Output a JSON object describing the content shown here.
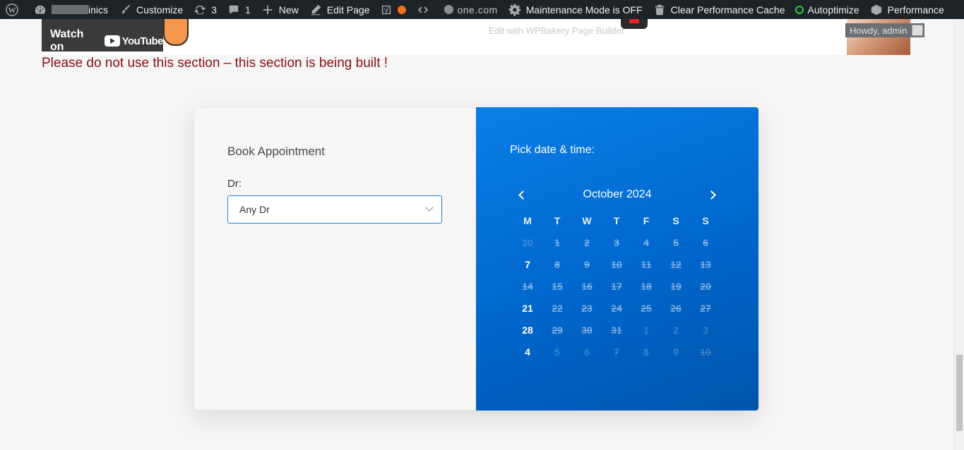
{
  "adminbar": {
    "site_suffix": "inics",
    "customize": "Customize",
    "updates_count": "3",
    "comments_count": "1",
    "new": "New",
    "edit_page": "Edit Page",
    "onecom": "one.com",
    "maintenance": "Maintenance Mode is OFF",
    "clear_cache": "Clear Performance Cache",
    "autoptimize": "Autoptimize",
    "performance": "Performance"
  },
  "video": {
    "watch_on": "Watch on",
    "youtube": "YouTube",
    "wpbakery": "Edit with WPBakery Page Builder",
    "howdy": "Howdy, admin"
  },
  "warning_text": "Please do not use this section – this section is being built !",
  "booking": {
    "title": "Book Appointment",
    "dr_label": "Dr:",
    "dr_value": "Any Dr",
    "pick_title": "Pick date & time:",
    "month": "October 2024",
    "weekdays": [
      "M",
      "T",
      "W",
      "T",
      "F",
      "S",
      "S"
    ],
    "weeks": [
      [
        {
          "d": "30",
          "s": "other"
        },
        {
          "d": "1",
          "s": "na"
        },
        {
          "d": "2",
          "s": "na"
        },
        {
          "d": "3",
          "s": "na"
        },
        {
          "d": "4",
          "s": "na"
        },
        {
          "d": "5",
          "s": "na"
        },
        {
          "d": "6",
          "s": "na"
        }
      ],
      [
        {
          "d": "7",
          "s": "avail"
        },
        {
          "d": "8",
          "s": "na"
        },
        {
          "d": "9",
          "s": "na"
        },
        {
          "d": "10",
          "s": "na"
        },
        {
          "d": "11",
          "s": "na"
        },
        {
          "d": "12",
          "s": "na"
        },
        {
          "d": "13",
          "s": "na"
        }
      ],
      [
        {
          "d": "14",
          "s": "na"
        },
        {
          "d": "15",
          "s": "na"
        },
        {
          "d": "16",
          "s": "na"
        },
        {
          "d": "17",
          "s": "na"
        },
        {
          "d": "18",
          "s": "na"
        },
        {
          "d": "19",
          "s": "na"
        },
        {
          "d": "20",
          "s": "na"
        }
      ],
      [
        {
          "d": "21",
          "s": "avail"
        },
        {
          "d": "22",
          "s": "na"
        },
        {
          "d": "23",
          "s": "na"
        },
        {
          "d": "24",
          "s": "na"
        },
        {
          "d": "25",
          "s": "na"
        },
        {
          "d": "26",
          "s": "na"
        },
        {
          "d": "27",
          "s": "na"
        }
      ],
      [
        {
          "d": "28",
          "s": "avail"
        },
        {
          "d": "29",
          "s": "na"
        },
        {
          "d": "30",
          "s": "na"
        },
        {
          "d": "31",
          "s": "na"
        },
        {
          "d": "1",
          "s": "other"
        },
        {
          "d": "2",
          "s": "other"
        },
        {
          "d": "3",
          "s": "other"
        }
      ],
      [
        {
          "d": "4",
          "s": "avail"
        },
        {
          "d": "5",
          "s": "other"
        },
        {
          "d": "6",
          "s": "other"
        },
        {
          "d": "7",
          "s": "other-strike"
        },
        {
          "d": "8",
          "s": "other"
        },
        {
          "d": "9",
          "s": "other"
        },
        {
          "d": "10",
          "s": "other-strike"
        }
      ]
    ]
  },
  "colors": {
    "adminbar_bg": "#1d2327",
    "warning": "#8b0d0d",
    "calendar_blue": "#0a7ee8",
    "select_border": "#1c7ed6"
  }
}
